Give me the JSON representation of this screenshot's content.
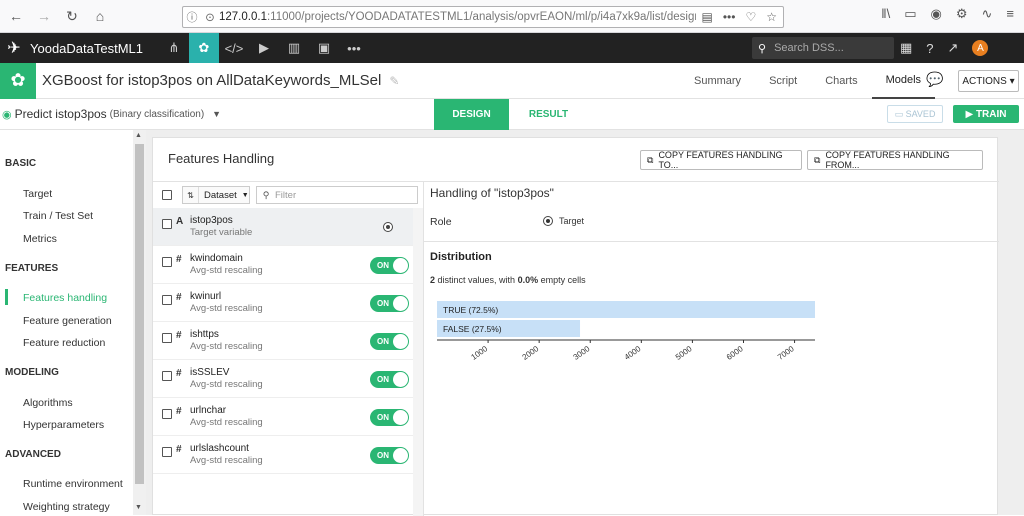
{
  "browser": {
    "url_host": "127.0.0.1",
    "url_rest": ":11000/projects/YOODADATATESTML1/analysis/opvrEAON/ml/p/i4a7xk9a/list/design"
  },
  "nav": {
    "project": "YoodaDataTestML1",
    "search_placeholder": "Search DSS..."
  },
  "object": {
    "title": "XGBoost for istop3pos on AllDataKeywords_MLSel",
    "tabs": [
      "Summary",
      "Script",
      "Charts",
      "Models"
    ],
    "actions_label": "ACTIONS"
  },
  "designbar": {
    "predict": "Predict istop3pos",
    "predict_type": "(Binary classification)",
    "design_tab": "DESIGN",
    "result_tab": "RESULT",
    "saved": "SAVED",
    "train": "TRAIN"
  },
  "sidebar": {
    "basic": "BASIC",
    "target": "Target",
    "train_test": "Train / Test Set",
    "metrics": "Metrics",
    "features": "FEATURES",
    "features_handling": "Features handling",
    "feature_generation": "Feature generation",
    "feature_reduction": "Feature reduction",
    "modeling": "MODELING",
    "algorithms": "Algorithms",
    "hyperparameters": "Hyperparameters",
    "advanced": "ADVANCED",
    "runtime": "Runtime environment",
    "weighting": "Weighting strategy"
  },
  "panel": {
    "title": "Features Handling",
    "copy_to": "COPY FEATURES HANDLING TO...",
    "copy_from": "COPY FEATURES HANDLING FROM...",
    "sort_label": "Dataset",
    "filter_placeholder": "Filter"
  },
  "features": [
    {
      "type": "A",
      "name": "istop3pos",
      "sub": "Target variable"
    },
    {
      "type": "#",
      "name": "kwindomain",
      "sub": "Avg-std rescaling",
      "toggle": "ON"
    },
    {
      "type": "#",
      "name": "kwinurl",
      "sub": "Avg-std rescaling",
      "toggle": "ON"
    },
    {
      "type": "#",
      "name": "ishttps",
      "sub": "Avg-std rescaling",
      "toggle": "ON"
    },
    {
      "type": "#",
      "name": "isSSLEV",
      "sub": "Avg-std rescaling",
      "toggle": "ON"
    },
    {
      "type": "#",
      "name": "urlnchar",
      "sub": "Avg-std rescaling",
      "toggle": "ON"
    },
    {
      "type": "#",
      "name": "urlslashcount",
      "sub": "Avg-std rescaling",
      "toggle": "ON"
    }
  ],
  "handling": {
    "title": "Handling of \"istop3pos\"",
    "role_label": "Role",
    "role_value": "Target",
    "dist_title": "Distribution",
    "dist_prefix": "2 distinct values, with ",
    "dist_pct": "0.0%",
    "dist_suffix": " empty cells"
  },
  "chart_data": {
    "type": "bar",
    "orientation": "horizontal",
    "categories": [
      "TRUE (72.5%)",
      "FALSE (27.5%)"
    ],
    "values": [
      7400,
      2800
    ],
    "xlim": [
      0,
      7400
    ],
    "xticks": [
      1000,
      2000,
      3000,
      4000,
      5000,
      6000,
      7000
    ],
    "bar_color": "#c7e0f7"
  }
}
